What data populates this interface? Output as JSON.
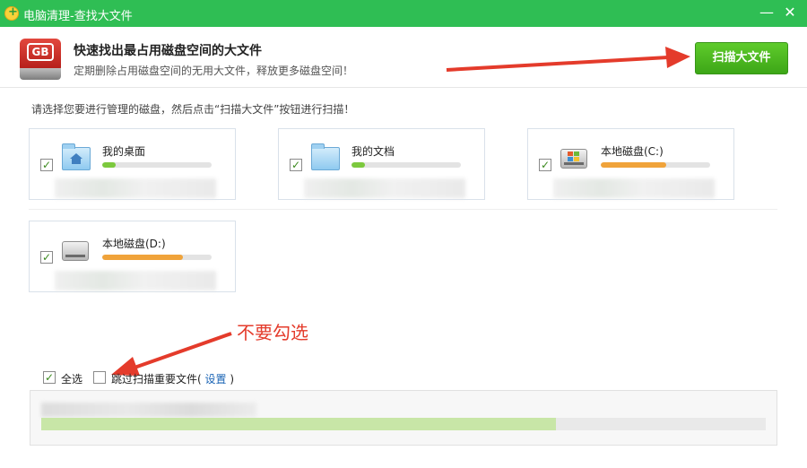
{
  "window": {
    "title": "电脑清理-查找大文件",
    "minimize_glyph": "—",
    "close_glyph": "✕"
  },
  "header": {
    "title": "快速找出最占用磁盘空间的大文件",
    "subtitle": "定期删除占用磁盘空间的无用大文件，释放更多磁盘空间！",
    "icon_text": "GB",
    "scan_button": "扫描大文件"
  },
  "instruction": "请选择您要进行管理的磁盘，然后点击“扫描大文件”按钮进行扫描！",
  "drives": [
    {
      "name": "我的桌面",
      "checked": true,
      "icon": "desktop-folder-icon",
      "usage_fraction": 0.12,
      "bar_color": "#7cc93d"
    },
    {
      "name": "我的文档",
      "checked": true,
      "icon": "documents-folder-icon",
      "usage_fraction": 0.12,
      "bar_color": "#7cc93d"
    },
    {
      "name": "本地磁盘(C:)",
      "checked": true,
      "icon": "system-drive-icon",
      "usage_fraction": 0.6,
      "bar_color": "#f0a33a"
    },
    {
      "name": "本地磁盘(D:)",
      "checked": true,
      "icon": "hard-drive-icon",
      "usage_fraction": 0.74,
      "bar_color": "#f0a33a"
    }
  ],
  "check_glyph": "✓",
  "annotation": "不要勾选",
  "options": {
    "select_all": "全选",
    "select_all_checked": true,
    "skip_important_prefix": "跳过扫描重要文件(",
    "settings_link": "设置",
    "skip_important_suffix": ")",
    "skip_important_checked": false
  },
  "progress": {
    "fraction": 0.71,
    "fill_color": "#c8e6a7"
  },
  "colors": {
    "titlebar": "#2fbe54",
    "accent_green": "#4cb820",
    "annotation_red": "#e43b2b"
  }
}
